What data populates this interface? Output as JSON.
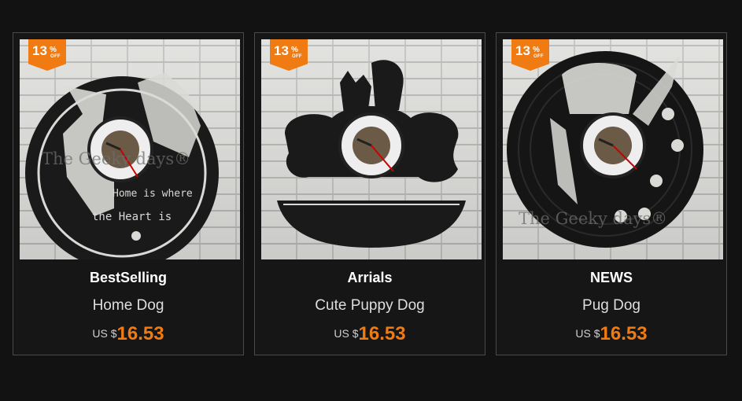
{
  "products": [
    {
      "title": "BestSelling",
      "name": "Home Dog",
      "currency": "US $",
      "price": "16.53",
      "discount": "13",
      "discount_unit": "%",
      "discount_label": "OFF",
      "watermark": "The Geeky days®",
      "clock_caption": [
        "Home is where",
        "the Heart is"
      ]
    },
    {
      "title": "Arrials",
      "name": "Cute Puppy Dog",
      "currency": "US $",
      "price": "16.53",
      "discount": "13",
      "discount_unit": "%",
      "discount_label": "OFF"
    },
    {
      "title": "NEWS",
      "name": "Pug Dog",
      "currency": "US $",
      "price": "16.53",
      "discount": "13",
      "discount_unit": "%",
      "discount_label": "OFF",
      "watermark": "The Geeky days®"
    }
  ],
  "colors": {
    "accent": "#f07b12",
    "background": "#121212",
    "card_border": "#4a4a4a"
  }
}
